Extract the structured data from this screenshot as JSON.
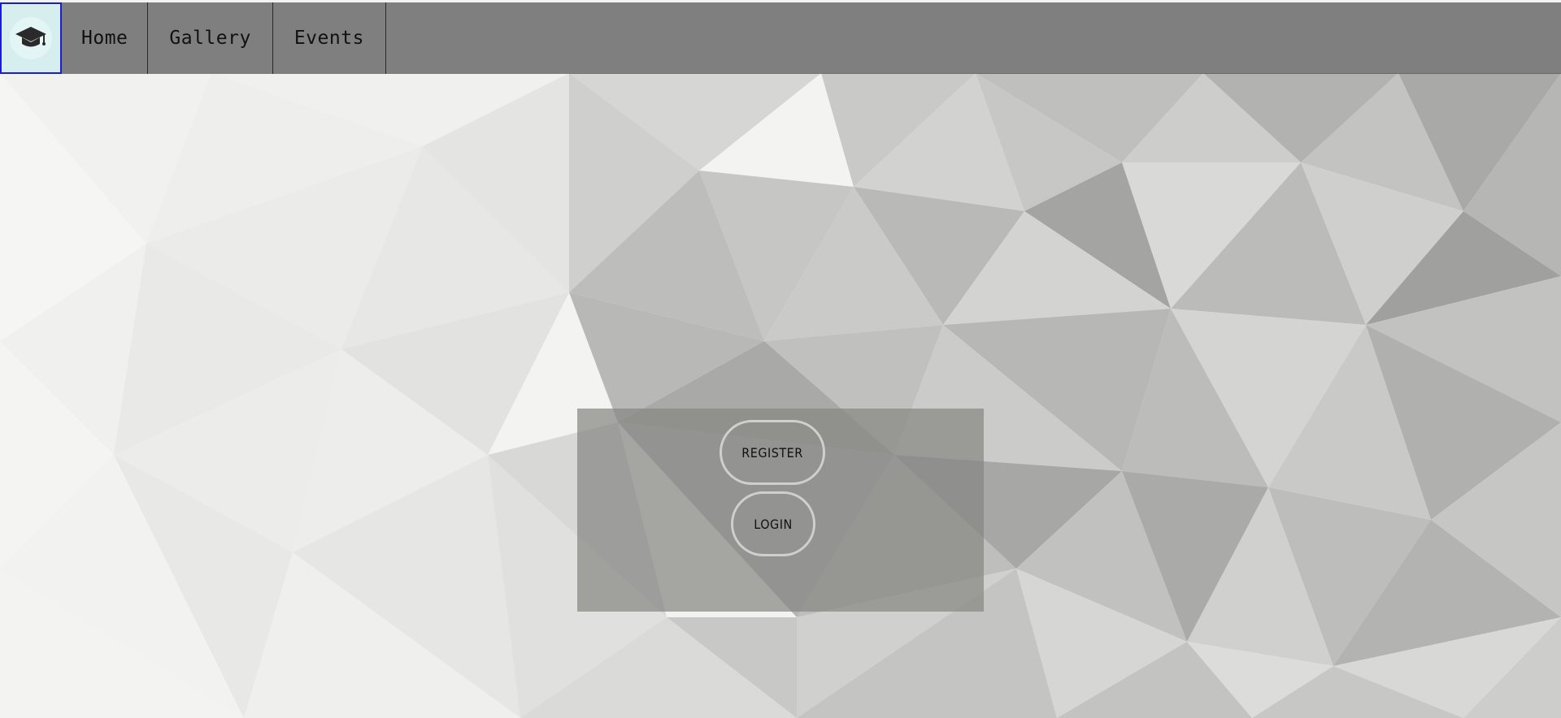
{
  "nav": {
    "logo_icon": "graduation-cap-icon",
    "items": [
      {
        "label": "Home"
      },
      {
        "label": "Gallery"
      },
      {
        "label": "Events"
      }
    ]
  },
  "auth": {
    "register_label": "REGISTER",
    "login_label": "LOGIN"
  },
  "colors": {
    "navbar": "#484848",
    "logo_border": "#1d1dd0",
    "panel": "#878784",
    "pill_border": "#cfcfcf"
  }
}
